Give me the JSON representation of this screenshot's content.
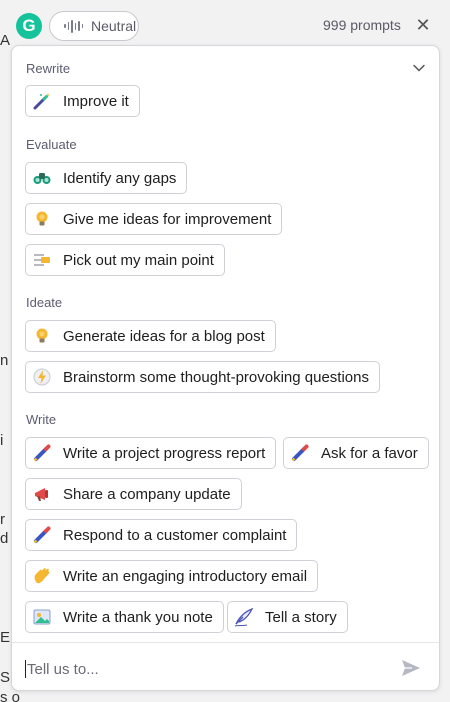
{
  "header": {
    "logo_letter": "G",
    "tone_label": "Neutral",
    "prompt_count": "999 prompts",
    "close_glyph": "✕"
  },
  "background_fragments": [
    "A",
    "n",
    "i",
    "r",
    "d",
    "E",
    "S",
    "s o"
  ],
  "sections": {
    "rewrite": {
      "title": "Rewrite",
      "items": [
        {
          "label": "Improve it",
          "icon": "magic-wand-icon"
        }
      ]
    },
    "evaluate": {
      "title": "Evaluate",
      "items": [
        {
          "label": "Identify any gaps",
          "icon": "binoculars-icon"
        },
        {
          "label": "Give me ideas for improvement",
          "icon": "lightbulb-icon"
        },
        {
          "label": "Pick out my main point",
          "icon": "highlight-text-icon"
        }
      ]
    },
    "ideate": {
      "title": "Ideate",
      "items": [
        {
          "label": "Generate ideas for a blog post",
          "icon": "lightbulb-icon"
        },
        {
          "label": "Brainstorm some thought-provoking questions",
          "icon": "lightning-bolt-icon"
        }
      ]
    },
    "write": {
      "title": "Write",
      "items": [
        {
          "label": "Write a project progress report",
          "icon": "pen-icon"
        },
        {
          "label": "Ask for a favor",
          "icon": "pen-icon"
        },
        {
          "label": "Share a company update",
          "icon": "megaphone-icon"
        },
        {
          "label": "Respond to a customer complaint",
          "icon": "pen-icon"
        },
        {
          "label": "Write an engaging introductory email",
          "icon": "waving-hand-icon"
        },
        {
          "label": "Write a thank you note",
          "icon": "card-icon"
        },
        {
          "label": "Tell a story",
          "icon": "quill-icon"
        }
      ]
    }
  },
  "composer": {
    "placeholder": "Tell us to...",
    "send_icon": "send-icon"
  },
  "colors": {
    "brand_green": "#15c39a",
    "border": "#d0d0d6",
    "section_text": "#5c5c70"
  }
}
